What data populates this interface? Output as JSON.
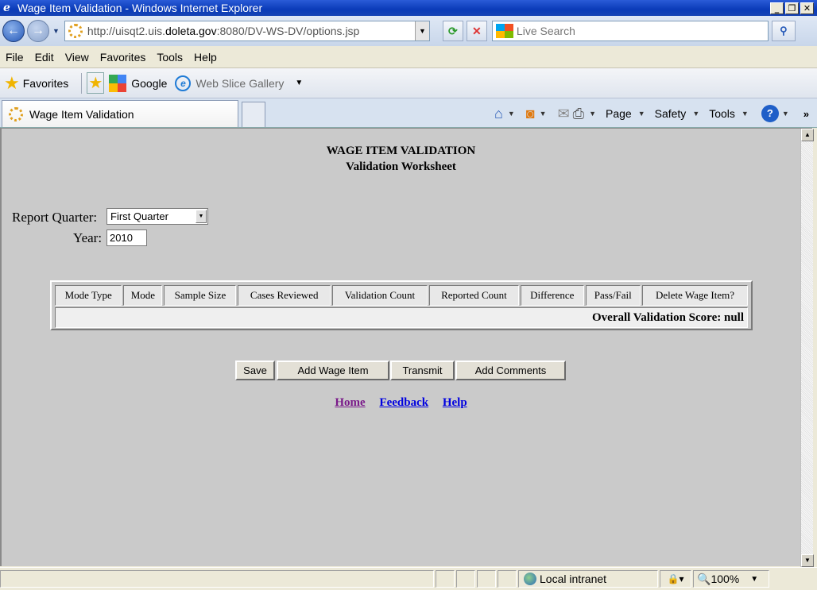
{
  "window": {
    "title": "Wage Item Validation - Windows Internet Explorer",
    "minimize": "_",
    "maximize": "❐",
    "close": "✕"
  },
  "address": {
    "url_prefix": "http://uisqt2.uis.",
    "url_domain": "doleta.gov",
    "url_suffix": ":8080/DV-WS-DV/options.jsp",
    "search_placeholder": "Live Search"
  },
  "menu": [
    "File",
    "Edit",
    "View",
    "Favorites",
    "Tools",
    "Help"
  ],
  "favorites_bar": {
    "favorites_label": "Favorites",
    "google_label": "Google",
    "web_slice_label": "Web Slice Gallery"
  },
  "tab": {
    "title": "Wage Item Validation"
  },
  "command_bar": {
    "page": "Page",
    "safety": "Safety",
    "tools": "Tools",
    "help": "?"
  },
  "page": {
    "title": "WAGE ITEM VALIDATION",
    "subtitle": "Validation Worksheet",
    "report_quarter_label": "Report Quarter:",
    "report_quarter_value": "First Quarter",
    "year_label": "Year:",
    "year_value": "2010",
    "table": {
      "columns": [
        "Mode Type",
        "Mode",
        "Sample Size",
        "Cases Reviewed",
        "Validation Count",
        "Reported Count",
        "Difference",
        "Pass/Fail",
        "Delete Wage Item?"
      ],
      "score_text": "Overall Validation Score: null"
    },
    "buttons": {
      "save": "Save",
      "add_wage_item": "Add Wage Item",
      "transmit": "Transmit",
      "add_comments": "Add Comments"
    },
    "links": {
      "home": "Home",
      "feedback": "Feedback",
      "help": "Help"
    }
  },
  "status": {
    "zone": "Local intranet",
    "zoom": "100%"
  }
}
